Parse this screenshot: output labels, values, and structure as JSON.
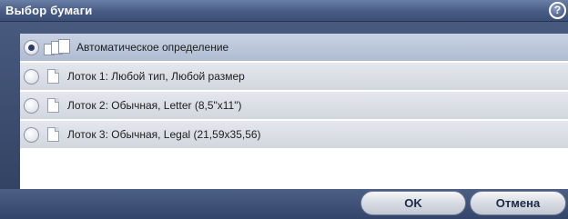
{
  "window": {
    "title": "Выбор бумаги",
    "help_icon": "?"
  },
  "options": [
    {
      "label": "Автоматическое определение",
      "selected": true,
      "icon": "auto-tray-icon"
    },
    {
      "label": "Лоток 1: Любой тип, Любой размер",
      "selected": false,
      "icon": "paper-icon"
    },
    {
      "label": "Лоток 2: Обычная, Letter (8,5\"x11\")",
      "selected": false,
      "icon": "paper-icon"
    },
    {
      "label": "Лоток 3: Обычная, Legal (21,59x35,56)",
      "selected": false,
      "icon": "paper-icon"
    }
  ],
  "buttons": {
    "ok": "OK",
    "cancel": "Отмена"
  }
}
